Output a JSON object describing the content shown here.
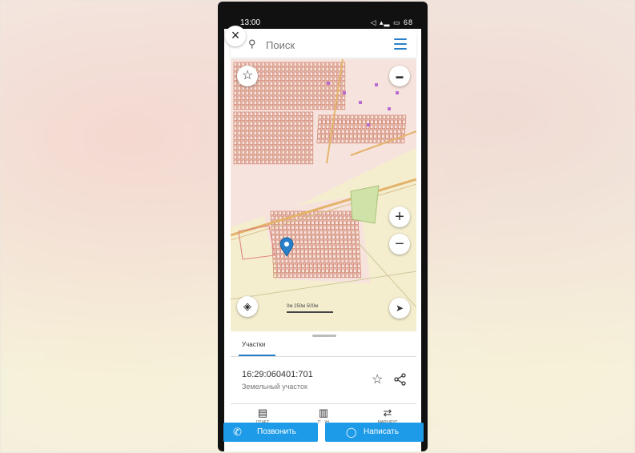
{
  "status_bar": {
    "time": "13:00",
    "indicators": "◁ ▴▂ ▭ 68"
  },
  "search": {
    "placeholder": "Поиск",
    "close_icon": "close-icon",
    "menu_icon": "hamburger-menu-icon"
  },
  "map": {
    "controls": [
      "star-icon",
      "layers-icon",
      "zoom-in-icon",
      "zoom-out-icon",
      "navigation-icon",
      "display-mode-icon"
    ],
    "zoom_in": "+",
    "zoom_out": "−",
    "scale_label": "0м    250м    500м"
  },
  "sheet": {
    "tab": "Участки",
    "cadastral_number": "16:29:060401:701",
    "object_type": "Земельный участок",
    "actions": [
      {
        "label": "ОТЧЕТ",
        "icon": "report-icon"
      },
      {
        "label": "ПЛАН",
        "icon": "map-icon"
      },
      {
        "label": "МАРШРУТ",
        "icon": "route-icon"
      }
    ]
  },
  "cta": {
    "call": "Позвонить",
    "write": "Написать"
  },
  "colors": {
    "accent": "#1e9be8",
    "menu": "#2a7fc9",
    "parcel": "#c9775f"
  }
}
